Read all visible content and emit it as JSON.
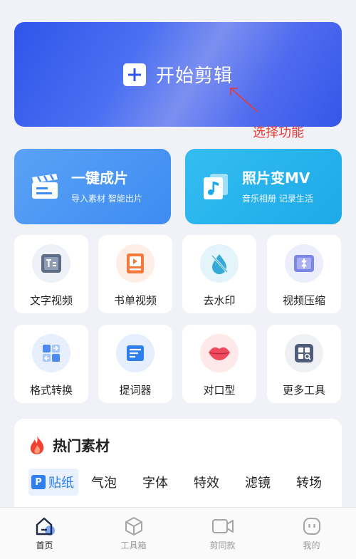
{
  "hero": {
    "title": "开始剪辑",
    "icon": "plus-icon"
  },
  "annotation": {
    "text": "选择功能",
    "color": "#e53935"
  },
  "features": [
    {
      "title": "一键成片",
      "subtitle": "导入素材 智能出片",
      "icon": "clapperboard-icon"
    },
    {
      "title": "照片变MV",
      "subtitle": "音乐相册 记录生活",
      "icon": "music-photo-icon"
    }
  ],
  "tools": [
    {
      "label": "文字视频",
      "icon": "text-video-icon"
    },
    {
      "label": "书单视频",
      "icon": "book-video-icon"
    },
    {
      "label": "去水印",
      "icon": "watermark-remove-icon"
    },
    {
      "label": "视频压缩",
      "icon": "compress-icon"
    },
    {
      "label": "格式转换",
      "icon": "format-convert-icon"
    },
    {
      "label": "提词器",
      "icon": "teleprompter-icon"
    },
    {
      "label": "对口型",
      "icon": "lips-icon"
    },
    {
      "label": "更多工具",
      "icon": "more-tools-icon"
    }
  ],
  "hot": {
    "title": "热门素材",
    "icon": "flame-icon",
    "tabs": [
      "贴纸",
      "气泡",
      "字体",
      "特效",
      "滤镜",
      "转场"
    ],
    "active_tab_badge": "P"
  },
  "nav": [
    {
      "label": "首页",
      "icon": "home-icon",
      "active": true
    },
    {
      "label": "工具箱",
      "icon": "toolbox-icon",
      "active": false
    },
    {
      "label": "剪同款",
      "icon": "video-camera-icon",
      "active": false
    },
    {
      "label": "我的",
      "icon": "profile-icon",
      "active": false
    }
  ],
  "colors": {
    "accent": "#2f7fef",
    "hero": "#3456e9",
    "annotation": "#e53935"
  }
}
